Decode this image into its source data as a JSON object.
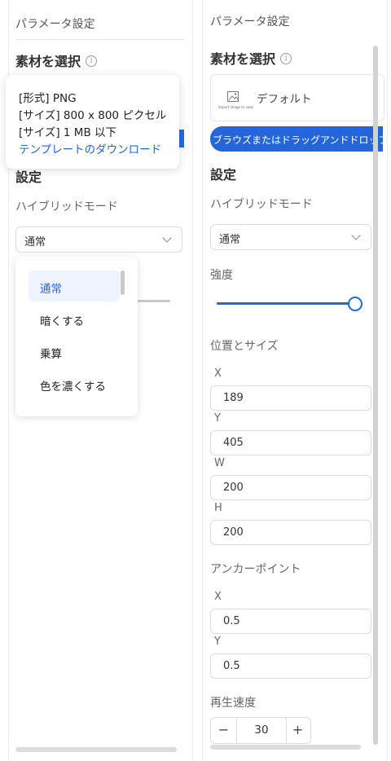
{
  "left": {
    "title": "パラメータ設定",
    "material_heading": "素材を選択",
    "info_glyph": "i",
    "tooltip": {
      "format": "[形式] PNG",
      "size_px": "[サイズ] 800 x 800 ピクセル",
      "size_mb": "[サイズ] 1 MB 以下",
      "template_link": "テンプレートのダウンロード"
    },
    "settings_heading": "設定",
    "blend_label": "ハイブリッドモード",
    "blend_value": "通常",
    "blend_options": [
      "通常",
      "暗くする",
      "乗算",
      "色を濃くする"
    ],
    "selected_option_index": 0
  },
  "right": {
    "title": "パラメータ設定",
    "material_heading": "素材を選択",
    "info_glyph": "i",
    "default_label": "デフォルト",
    "thumb_caption": "Import image to view",
    "upload_button": "ブラウズまたはドラッグアンドドロップ",
    "settings_heading": "設定",
    "blend_label": "ハイブリッドモード",
    "blend_value": "通常",
    "strength_label": "強度",
    "strength_value": 1.0,
    "position_size_label": "位置とサイズ",
    "x_label": "X",
    "x_value": "189",
    "y_label": "Y",
    "y_value": "405",
    "w_label": "W",
    "w_value": "200",
    "h_label": "H",
    "h_value": "200",
    "anchor_label": "アンカーポイント",
    "anchor_x_label": "X",
    "anchor_x_value": "0.5",
    "anchor_y_label": "Y",
    "anchor_y_value": "0.5",
    "speed_label": "再生速度",
    "speed_minus": "−",
    "speed_value": "30",
    "speed_plus": "+"
  },
  "colors": {
    "accent": "#2466d9",
    "selected_bg": "#eef3fd"
  }
}
